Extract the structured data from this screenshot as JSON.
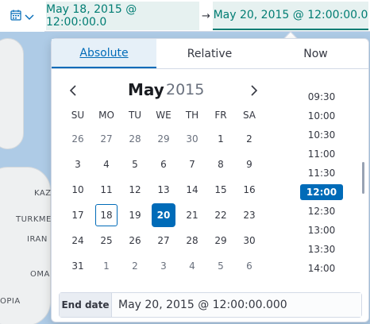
{
  "map": {
    "labels": [
      "KAZ",
      "TURKME",
      "IRAN",
      "OMA",
      "OPIA"
    ]
  },
  "toolbar": {
    "start_date": "May 18, 2015 @ 12:00:00.0",
    "arrow": "→",
    "end_date": "May 20, 2015 @ 12:00:00.0"
  },
  "tabs": {
    "absolute": "Absolute",
    "relative": "Relative",
    "now": "Now"
  },
  "calendar": {
    "month": "May",
    "year": "2015",
    "weekdays": [
      "SU",
      "MO",
      "TU",
      "WE",
      "TH",
      "FR",
      "SA"
    ],
    "weeks": [
      [
        "26",
        "27",
        "28",
        "29",
        "30",
        "1",
        "2"
      ],
      [
        "3",
        "4",
        "5",
        "6",
        "7",
        "8",
        "9"
      ],
      [
        "10",
        "11",
        "12",
        "13",
        "14",
        "15",
        "16"
      ],
      [
        "17",
        "18",
        "19",
        "20",
        "21",
        "22",
        "23"
      ],
      [
        "24",
        "25",
        "26",
        "27",
        "28",
        "29",
        "30"
      ],
      [
        "31",
        "1",
        "2",
        "3",
        "4",
        "5",
        "6"
      ]
    ],
    "selected_day": "20",
    "range_start_day": "18"
  },
  "times": [
    "09:30",
    "10:00",
    "10:30",
    "11:00",
    "11:30",
    "12:00",
    "12:30",
    "13:00",
    "13:30",
    "14:00"
  ],
  "selected_time": "12:00",
  "end_field": {
    "label": "End date",
    "value": "May 20, 2015 @ 12:00:00.000"
  },
  "colors": {
    "accent": "#006bb8",
    "range_text": "#017d73",
    "range_bg": "#e6f1f0"
  }
}
